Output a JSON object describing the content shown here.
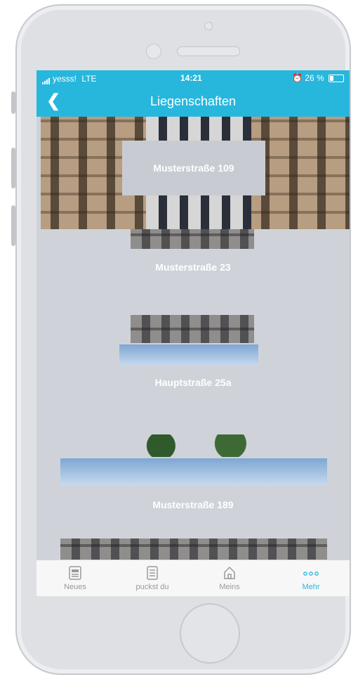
{
  "status_bar": {
    "carrier": "yesss!",
    "network": "LTE",
    "time": "14:21",
    "battery": "26 %",
    "alarm_icon": "alarm-icon"
  },
  "nav_bar": {
    "back_icon": "chevron-left-icon",
    "title": "Liegenschaften"
  },
  "properties": [
    {
      "name": "Musterstraße 109"
    },
    {
      "name": "Musterstraße 23"
    },
    {
      "name": "Hauptstraße 25a"
    },
    {
      "name": "Musterstraße 189"
    }
  ],
  "tab_bar": {
    "tabs": [
      {
        "label": "Neues",
        "icon": "newspaper-icon",
        "active": false
      },
      {
        "label": "puckst du",
        "icon": "document-icon",
        "active": false
      },
      {
        "label": "Meins",
        "icon": "home-icon",
        "active": false
      },
      {
        "label": "Mehr",
        "icon": "more-dots-icon",
        "active": true
      }
    ]
  },
  "colors": {
    "accent": "#27b7dd",
    "background": "#cfd3d9"
  }
}
